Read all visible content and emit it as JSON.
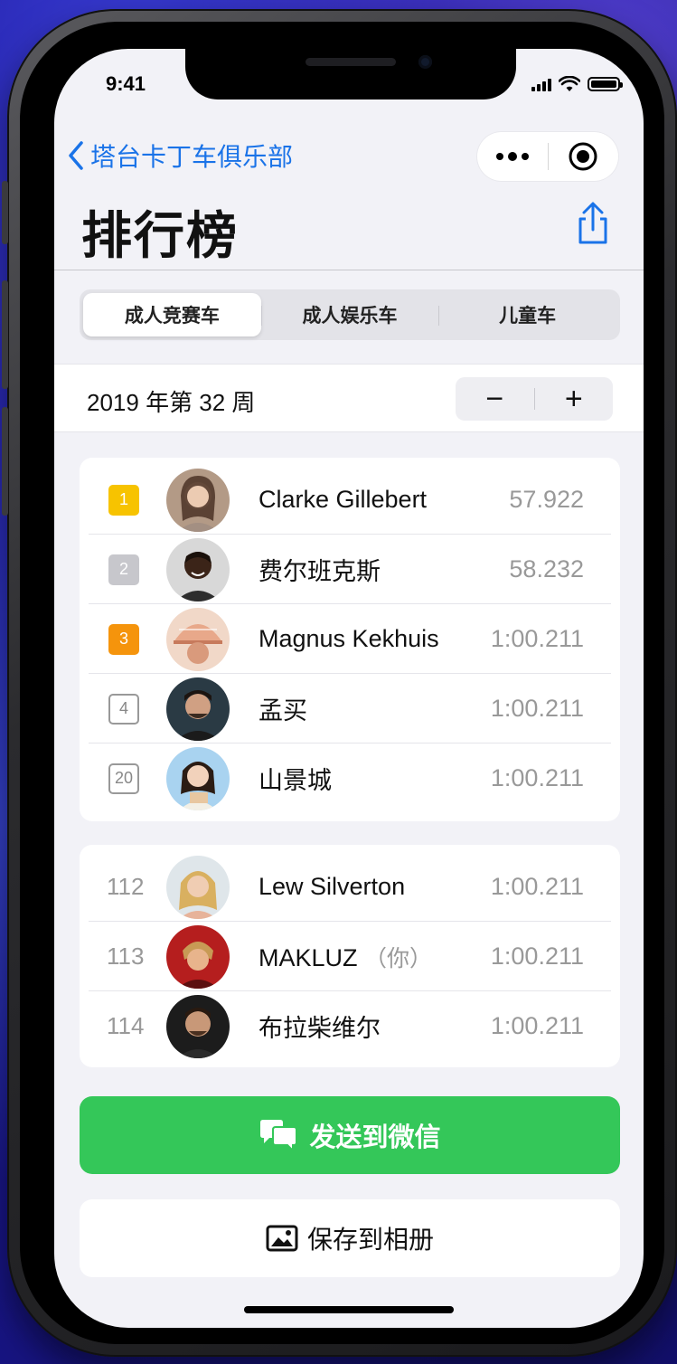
{
  "status_bar": {
    "time": "9:41"
  },
  "nav": {
    "back_label": "塔台卡丁车俱乐部",
    "capsule": {
      "more_icon": "more-dots-icon",
      "close_icon": "record-circle-icon"
    }
  },
  "header": {
    "title": "排行榜",
    "share_icon": "share-icon"
  },
  "tabs": [
    {
      "label": "成人竞赛车",
      "active": true
    },
    {
      "label": "成人娱乐车",
      "active": false
    },
    {
      "label": "儿童车",
      "active": false
    }
  ],
  "week": {
    "label": "2019 年第 32 周",
    "minus_label": "−",
    "plus_label": "+"
  },
  "leaderboard_top": [
    {
      "rank": "1",
      "badge": "gold",
      "name": "Clarke Gillebert",
      "time": "57.922"
    },
    {
      "rank": "2",
      "badge": "silver",
      "name": "费尔班克斯",
      "time": "58.232"
    },
    {
      "rank": "3",
      "badge": "bronze",
      "name": "Magnus Kekhuis",
      "time": "1:00.211"
    },
    {
      "rank": "4",
      "badge": "plain",
      "name": "孟买",
      "time": "1:00.211"
    },
    {
      "rank": "20",
      "badge": "plain",
      "name": "山景城",
      "time": "1:00.211"
    }
  ],
  "leaderboard_self": [
    {
      "rank": "112",
      "name": "Lew Silverton",
      "suffix": "",
      "time": "1:00.211"
    },
    {
      "rank": "113",
      "name": "MAKLUZ",
      "suffix": "（你）",
      "time": "1:00.211"
    },
    {
      "rank": "114",
      "name": "布拉柴维尔",
      "suffix": "",
      "time": "1:00.211"
    }
  ],
  "actions": {
    "wechat_label": "发送到微信",
    "save_label": "保存到相册"
  },
  "colors": {
    "accent_blue": "#1a73e8",
    "wechat_green": "#34c759",
    "gold": "#f7c300",
    "silver": "#c7c7cc",
    "bronze": "#f5940c"
  }
}
